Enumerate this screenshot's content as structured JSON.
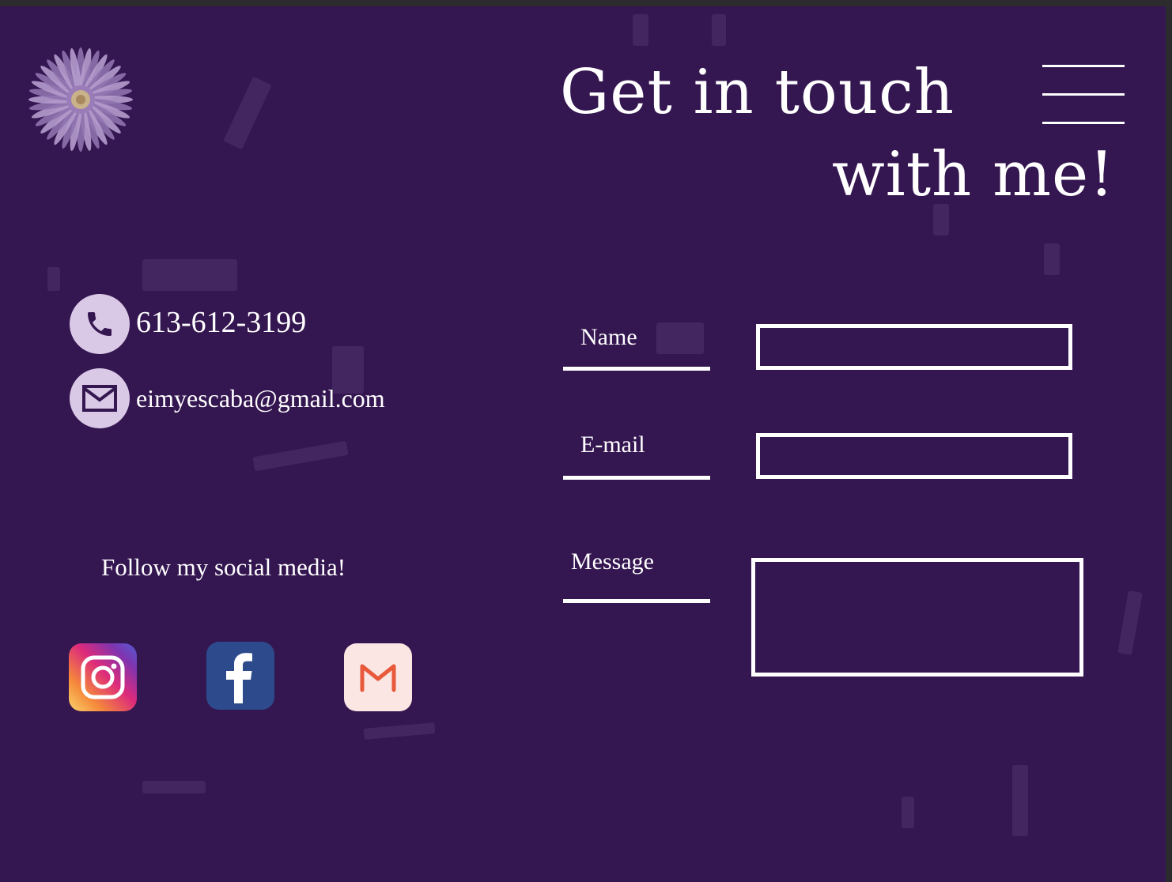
{
  "header": {
    "headline_line1": "Get in touch",
    "headline_line2": "with me!",
    "logo_icon": "flower-icon",
    "menu_icon": "hamburger-menu-icon"
  },
  "contact": {
    "phone": "613-612-3199",
    "phone_icon": "phone-icon",
    "email": "eimyescaba@gmail.com",
    "email_icon": "envelope-icon"
  },
  "social": {
    "heading": "Follow my social media!",
    "links": [
      {
        "icon": "instagram-icon"
      },
      {
        "icon": "facebook-icon"
      },
      {
        "icon": "gmail-icon"
      }
    ]
  },
  "form": {
    "name_label": "Name",
    "name_value": "",
    "email_label": "E-mail",
    "email_value": "",
    "message_label": "Message",
    "message_value": ""
  },
  "colors": {
    "background": "#341650",
    "text": "#ffffff",
    "icon_circle": "#d9c9e6",
    "facebook": "#2d4b8c",
    "gmail_bg": "#fbe6e3",
    "gmail_m": "#e8593c"
  }
}
